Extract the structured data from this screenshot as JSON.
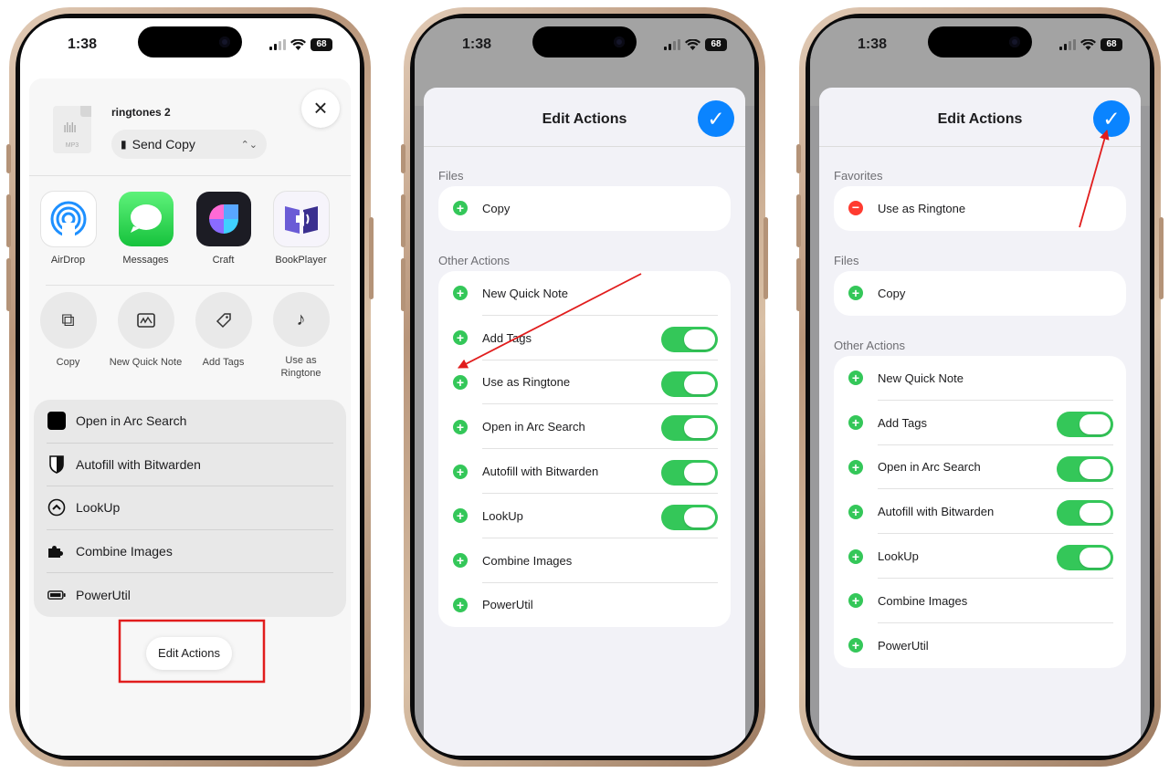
{
  "status_bar": {
    "time": "1:38",
    "battery": "68"
  },
  "screen1": {
    "file_name": "ringtones 2",
    "file_ext": "MP3",
    "send_mode": "Send Copy",
    "apps": [
      {
        "label": "AirDrop",
        "icon": "airdrop-icon"
      },
      {
        "label": "Messages",
        "icon": "messages-icon"
      },
      {
        "label": "Craft",
        "icon": "craft-icon"
      },
      {
        "label": "BookPlayer",
        "icon": "bookplayer-icon"
      }
    ],
    "quick_actions": [
      {
        "label": "Copy",
        "icon": "copy-icon"
      },
      {
        "label": "New Quick Note",
        "icon": "quick-note-icon"
      },
      {
        "label": "Add Tags",
        "icon": "tag-icon"
      },
      {
        "label": "Use as Ringtone",
        "icon": "music-note-icon"
      }
    ],
    "list": [
      {
        "label": "Open in Arc Search",
        "icon": "arc-search-icon"
      },
      {
        "label": "Autofill with Bitwarden",
        "icon": "bitwarden-shield-icon"
      },
      {
        "label": "LookUp",
        "icon": "lookup-icon"
      },
      {
        "label": "Combine Images",
        "icon": "puzzle-icon"
      },
      {
        "label": "PowerUtil",
        "icon": "battery-icon"
      }
    ],
    "edit_actions": "Edit Actions"
  },
  "screen2": {
    "title": "Edit Actions",
    "files_header": "Files",
    "files": [
      {
        "label": "Copy",
        "toggle": false
      }
    ],
    "other_header": "Other Actions",
    "other": [
      {
        "label": "New Quick Note",
        "toggle": false
      },
      {
        "label": "Add Tags",
        "toggle": true
      },
      {
        "label": "Use as Ringtone",
        "toggle": true
      },
      {
        "label": "Open in Arc Search",
        "toggle": true
      },
      {
        "label": "Autofill with Bitwarden",
        "toggle": true
      },
      {
        "label": "LookUp",
        "toggle": true
      },
      {
        "label": "Combine Images",
        "toggle": false
      },
      {
        "label": "PowerUtil",
        "toggle": false
      }
    ]
  },
  "screen3": {
    "title": "Edit Actions",
    "favorites_header": "Favorites",
    "favorites": [
      {
        "label": "Use as Ringtone",
        "toggle": false
      }
    ],
    "files_header": "Files",
    "files": [
      {
        "label": "Copy",
        "toggle": false
      }
    ],
    "other_header": "Other Actions",
    "other": [
      {
        "label": "New Quick Note",
        "toggle": false
      },
      {
        "label": "Add Tags",
        "toggle": true
      },
      {
        "label": "Open in Arc Search",
        "toggle": true
      },
      {
        "label": "Autofill with Bitwarden",
        "toggle": true
      },
      {
        "label": "LookUp",
        "toggle": true
      },
      {
        "label": "Combine Images",
        "toggle": false
      },
      {
        "label": "PowerUtil",
        "toggle": false
      }
    ]
  },
  "colors": {
    "accent": "#0a84ff",
    "toggle_on": "#34c759",
    "add": "#34c759",
    "remove": "#ff3b30",
    "annotation": "#e11d1d"
  }
}
